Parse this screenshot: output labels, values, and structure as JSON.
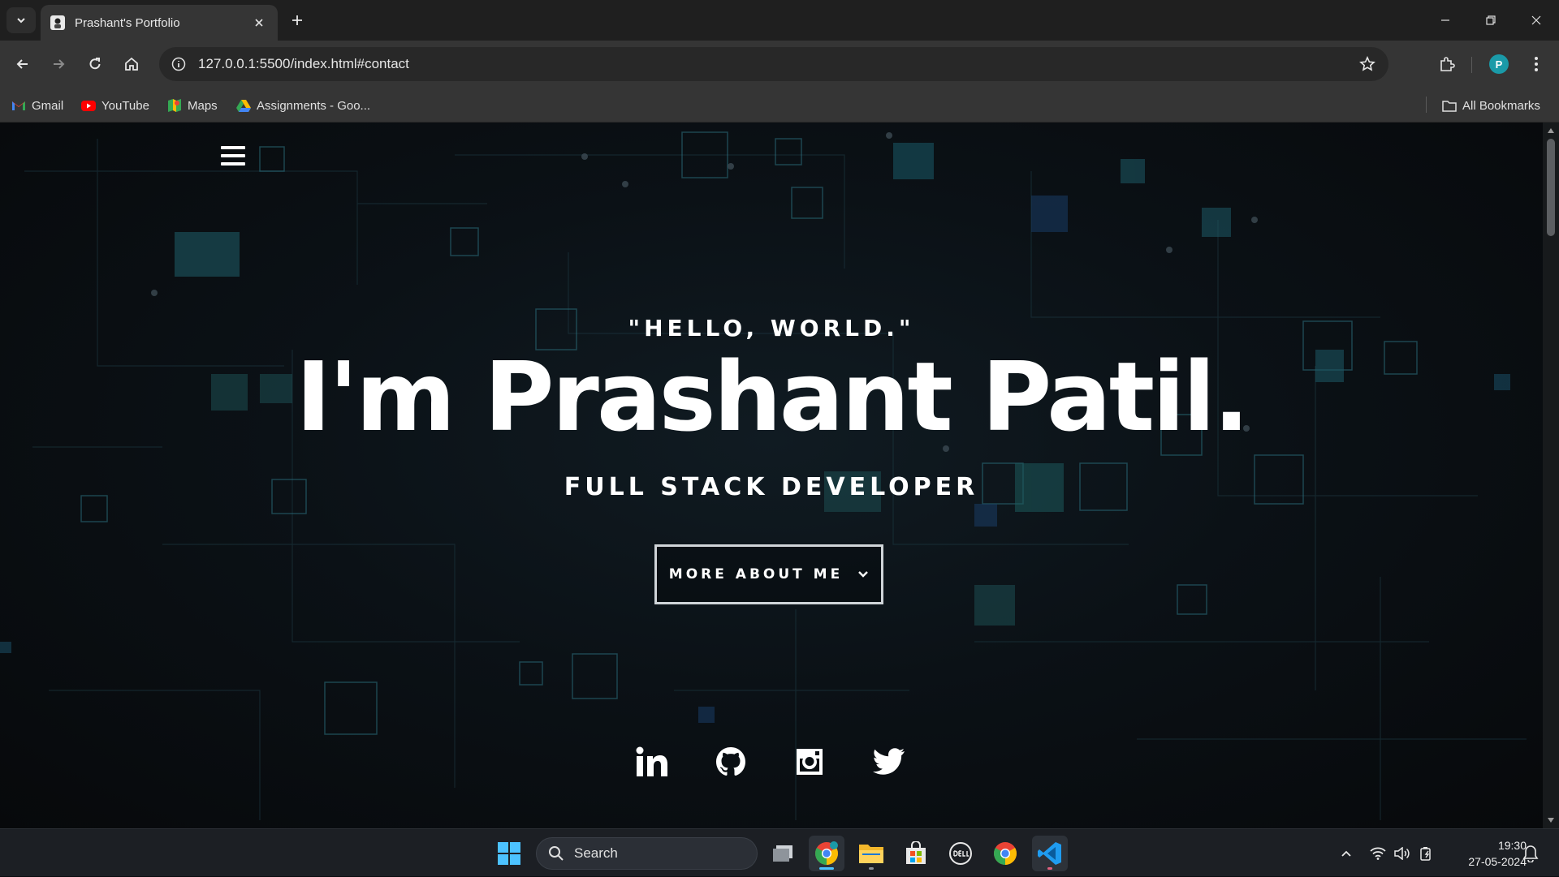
{
  "browser": {
    "tab_title": "Prashant's Portfolio",
    "url": "127.0.0.1:5500/index.html#contact",
    "profile_initial": "P",
    "bookmarks": [
      {
        "label": "Gmail",
        "icon": "gmail-icon"
      },
      {
        "label": "YouTube",
        "icon": "youtube-icon"
      },
      {
        "label": "Maps",
        "icon": "maps-icon"
      },
      {
        "label": "Assignments - Goo...",
        "icon": "google-drive-icon"
      }
    ],
    "all_bookmarks_label": "All Bookmarks"
  },
  "page": {
    "kicker": "\"HELLO, WORLD.\"",
    "name": "I'm Prashant Patil.",
    "role": "FULL STACK DEVELOPER",
    "more_button_label": "MORE ABOUT ME",
    "socials": [
      {
        "name": "linkedin",
        "icon": "linkedin-icon"
      },
      {
        "name": "github",
        "icon": "github-icon"
      },
      {
        "name": "instagram",
        "icon": "instagram-icon"
      },
      {
        "name": "twitter",
        "icon": "twitter-icon"
      }
    ]
  },
  "taskbar": {
    "search_label": "Search",
    "time": "19:30",
    "date": "27-05-2024"
  },
  "colors": {
    "chrome_dark": "#1f1f1f",
    "chrome_toolbar": "#353535",
    "page_bg": "#0a0c0f",
    "text_white": "#ffffff",
    "taskbar_bg": "#1c1f24",
    "accent_blue": "#4cc2ff"
  }
}
